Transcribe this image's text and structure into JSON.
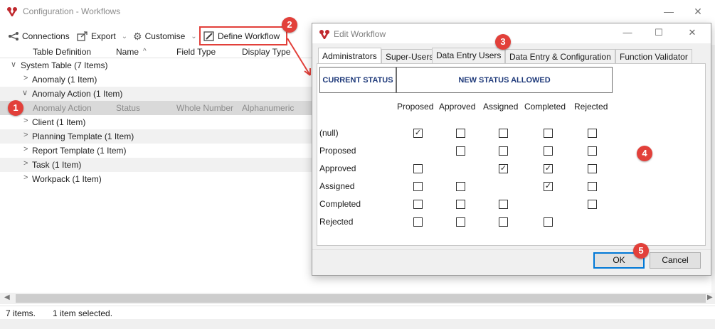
{
  "window": {
    "title": "Configuration - Workflows",
    "controls": {
      "minimize": "—",
      "close": "✕"
    }
  },
  "toolbar": {
    "connections": "Connections",
    "export": "Export",
    "customise": "Customise",
    "define_workflow": "Define Workflow"
  },
  "grid": {
    "columns": [
      "Table Definition",
      "Name",
      "Field Type",
      "Display Type"
    ],
    "sort_indicator": "^",
    "rows": [
      {
        "label": "System Table (7 Items)",
        "chevron": "∨"
      },
      {
        "label": "Anomaly (1 Item)",
        "chevron": ">"
      },
      {
        "label": "Anomaly Action (1 Item)",
        "chevron": "∨"
      },
      {
        "label": "Client (1 Item)",
        "chevron": ">"
      },
      {
        "label": "Planning Template (1 Item)",
        "chevron": ">"
      },
      {
        "label": "Report Template (1 Item)",
        "chevron": ">"
      },
      {
        "label": "Task (1 Item)",
        "chevron": ">"
      },
      {
        "label": "Workpack (1 Item)",
        "chevron": ">"
      }
    ],
    "selected_row": {
      "table_definition": "Anomaly Action",
      "name": "Status",
      "field_type": "Whole Number",
      "display_type": "Alphanumeric"
    }
  },
  "status_bar": {
    "count": "7 items.",
    "selection": "1 item selected."
  },
  "dialog": {
    "title": "Edit Workflow",
    "controls": {
      "minimize": "—",
      "maximize": "☐",
      "close": "✕"
    },
    "tabs": [
      "Administrators",
      "Super-Users",
      "Data Entry Users",
      "Data Entry & Configuration",
      "Function Validator"
    ],
    "active_tab": "Administrators",
    "current_status_header": "CURRENT STATUS",
    "new_status_header": "NEW STATUS ALLOWED",
    "columns": [
      "Proposed",
      "Approved",
      "Assigned",
      "Completed",
      "Rejected"
    ],
    "rows": [
      {
        "label": "(null)",
        "cells": [
          true,
          false,
          false,
          false,
          false
        ]
      },
      {
        "label": "Proposed",
        "cells": [
          null,
          false,
          false,
          false,
          false
        ]
      },
      {
        "label": "Approved",
        "cells": [
          false,
          null,
          true,
          true,
          false
        ]
      },
      {
        "label": "Assigned",
        "cells": [
          false,
          false,
          null,
          true,
          false
        ]
      },
      {
        "label": "Completed",
        "cells": [
          false,
          false,
          false,
          null,
          false
        ]
      },
      {
        "label": "Rejected",
        "cells": [
          false,
          false,
          false,
          false,
          null
        ]
      }
    ],
    "ok_label": "OK",
    "cancel_label": "Cancel"
  },
  "callouts": [
    "1",
    "2",
    "3",
    "4",
    "5"
  ],
  "colors": {
    "callout": "#e2403a",
    "header_text": "#1f3a7a",
    "selected_row": "#d9d9d9",
    "default_button_border": "#0078d7"
  }
}
